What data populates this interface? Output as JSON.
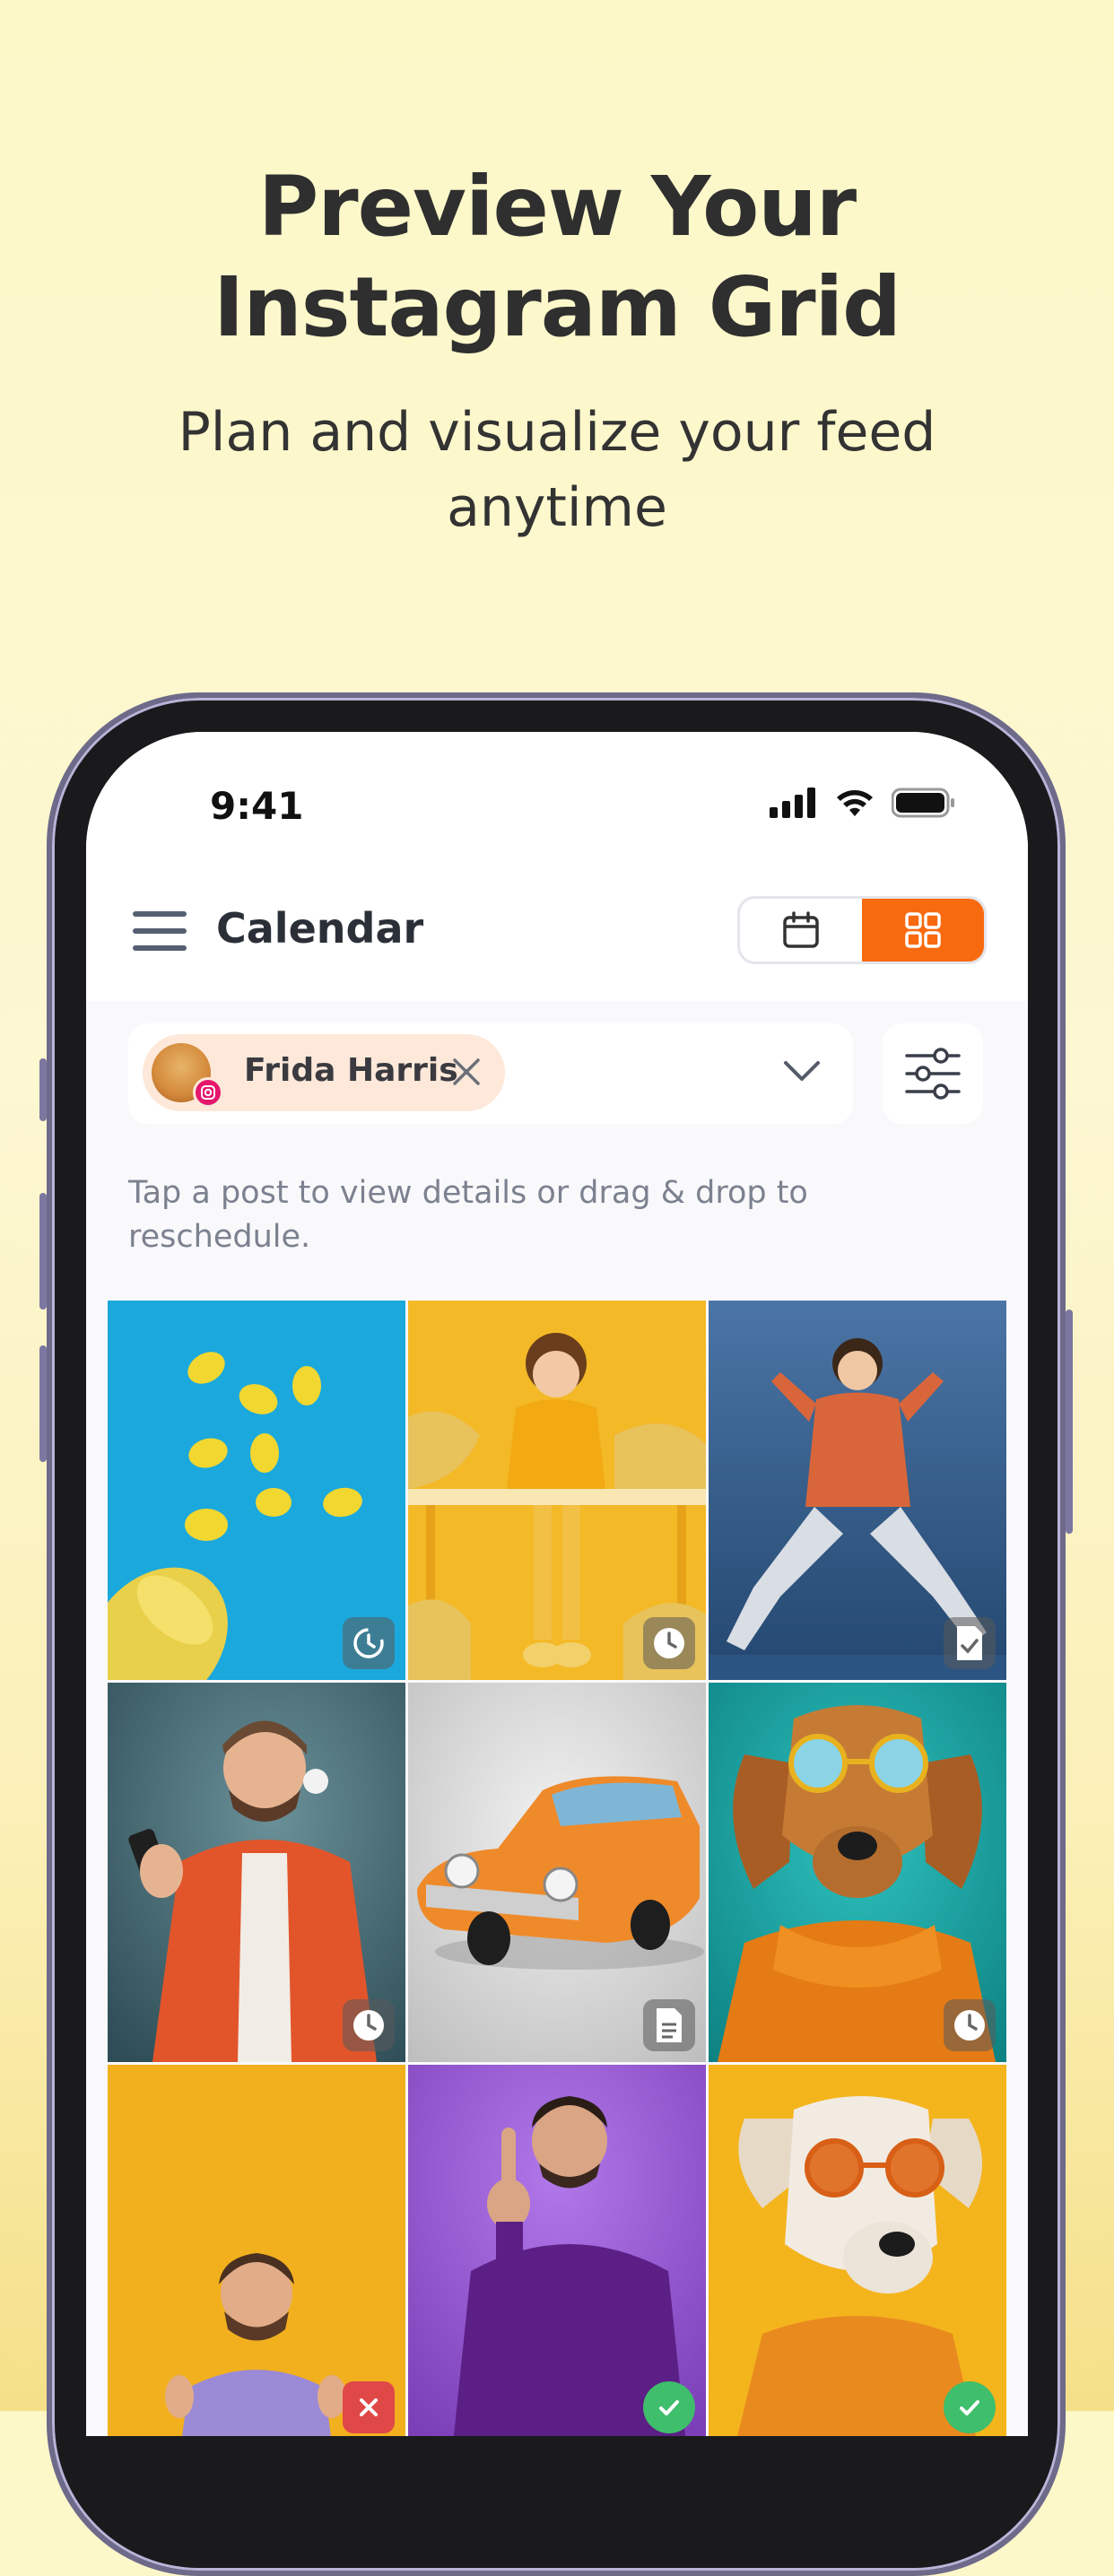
{
  "headline": {
    "line1": "Preview Your",
    "line2": "Instagram Grid"
  },
  "subheadline": {
    "line1": "Plan and visualize your feed",
    "line2": "anytime"
  },
  "status_bar": {
    "time": "9:41"
  },
  "app_bar": {
    "title": "Calendar"
  },
  "account_filter": {
    "selected_account": "Frida Harris"
  },
  "hint_text": {
    "line1": "Tap a post to view details or drag & drop to",
    "line2": "reschedule."
  },
  "colors": {
    "accent": "#f86a10",
    "background": "#fdf8c8"
  },
  "grid_posts": [
    {
      "scene": "lemons on blue",
      "status_icon": "recurring-clock-icon"
    },
    {
      "scene": "woman at yellow desk",
      "status_icon": "clock-icon"
    },
    {
      "scene": "jumping woman",
      "status_icon": "document-check-icon"
    },
    {
      "scene": "man with headphones",
      "status_icon": "clock-icon"
    },
    {
      "scene": "orange vintage car",
      "status_icon": "document-icon"
    },
    {
      "scene": "dog with sunglasses",
      "status_icon": "clock-icon"
    },
    {
      "scene": "man thumbs up",
      "status_icon": "failed-icon"
    },
    {
      "scene": "man pointing up",
      "status_icon": "published-check-icon"
    },
    {
      "scene": "dog in orange sunglasses",
      "status_icon": "published-check-icon"
    }
  ]
}
